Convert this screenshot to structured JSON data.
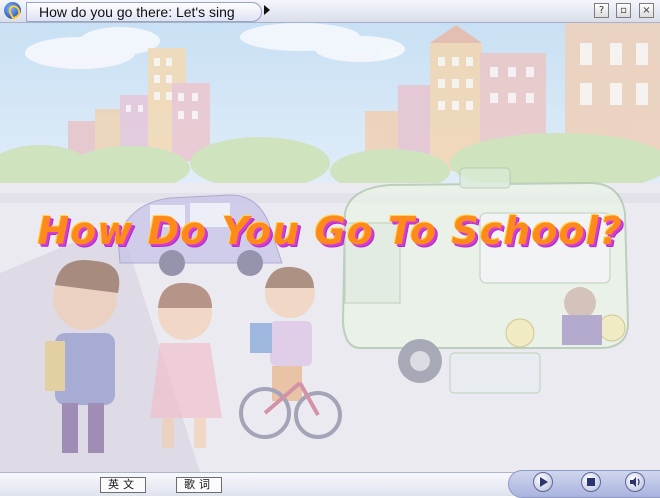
{
  "window": {
    "title": "How do you go there: Let's sing",
    "help_label": "?",
    "restore_label": "▫",
    "close_label": "×"
  },
  "scene": {
    "headline": "How Do You Go To School?"
  },
  "bottombar": {
    "english_label": "英文",
    "lyrics_label": "歌词"
  },
  "icons": {
    "logo": "app-logo-icon",
    "play": "play-icon",
    "stop": "stop-icon",
    "sound": "speaker-icon"
  },
  "colors": {
    "headline_fill": "#ff8a1c",
    "headline_outline": "#d63bd6",
    "toolbar_accent": "#2a3470"
  }
}
